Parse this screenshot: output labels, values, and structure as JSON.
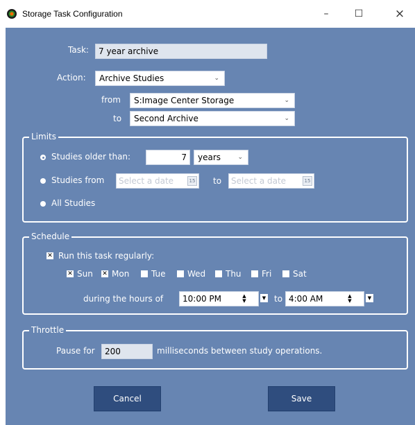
{
  "window": {
    "title": "Storage Task Configuration",
    "controls": {
      "minimize": "–",
      "maximize": "☐",
      "close": "×"
    }
  },
  "form": {
    "task_label": "Task:",
    "task_value": "7 year archive",
    "action_label": "Action:",
    "action_value": "Archive Studies",
    "from_label": "from",
    "from_value": "S:Image Center Storage",
    "to_label": "to",
    "to_value": "Second Archive"
  },
  "limits": {
    "title": "Limits",
    "older_than_label": "Studies older than:",
    "older_than_value": "7",
    "unit_value": "years",
    "studies_from_label": "Studies from",
    "date_placeholder_from": "Select a date",
    "date_to_label": "to",
    "date_placeholder_to": "Select a date",
    "calendar_day": "15",
    "all_studies_label": "All Studies",
    "selected_option": "older_than"
  },
  "schedule": {
    "title": "Schedule",
    "run_regularly_label": "Run this task regularly:",
    "run_regularly_checked": true,
    "days": [
      {
        "label": "Sun",
        "checked": true
      },
      {
        "label": "Mon",
        "checked": true
      },
      {
        "label": "Tue",
        "checked": false
      },
      {
        "label": "Wed",
        "checked": false
      },
      {
        "label": "Thu",
        "checked": false
      },
      {
        "label": "Fri",
        "checked": false
      },
      {
        "label": "Sat",
        "checked": false
      }
    ],
    "hours_label": "during the hours of",
    "start_time": "10:00 PM",
    "hours_to_label": "to",
    "end_time": "4:00 AM"
  },
  "throttle": {
    "title": "Throttle",
    "pause_label": "Pause for",
    "pause_value": "200",
    "pause_suffix": "milliseconds between study operations."
  },
  "buttons": {
    "cancel": "Cancel",
    "save": "Save"
  },
  "colors": {
    "panel_background": "#6785b2",
    "button_background": "#2f4d7e",
    "text": "#ffffff"
  }
}
